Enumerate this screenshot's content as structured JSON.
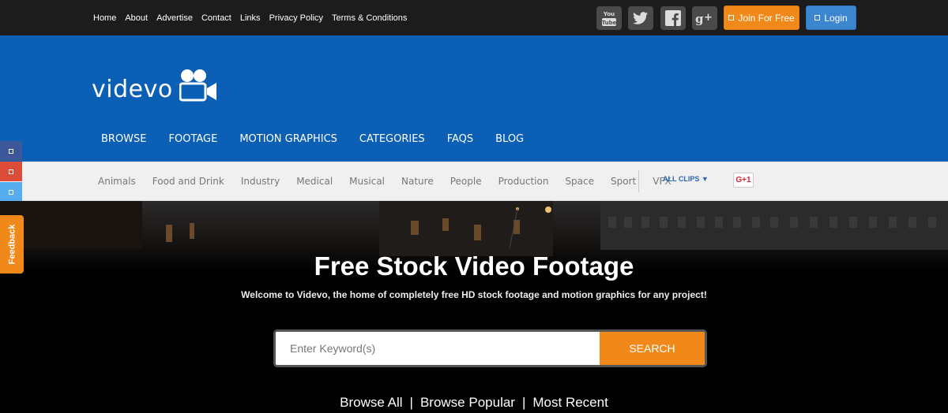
{
  "top_nav": [
    "Home",
    "About",
    "Advertise",
    "Contact",
    "Links",
    "Privacy Policy",
    "Terms & Conditions"
  ],
  "social_icons": [
    "youtube-icon",
    "twitter-icon",
    "facebook-icon",
    "google-plus-icon"
  ],
  "youtube_label": "You Tube",
  "buttons": {
    "join": "Join For Free",
    "login": "Login"
  },
  "logo": {
    "text": "videvo",
    "icon": "video-camera-icon"
  },
  "main_nav": [
    "BROWSE",
    "FOOTAGE",
    "MOTION GRAPHICS",
    "CATEGORIES",
    "FAQS",
    "BLOG"
  ],
  "categories": [
    "Animals",
    "Food and Drink",
    "Industry",
    "Medical",
    "Musical",
    "Nature",
    "People",
    "Production",
    "Space",
    "Sport",
    "VFX"
  ],
  "all_clips": "ALL CLIPS ▼",
  "gplus_button": "G+1",
  "side_tabs": {
    "feedback": "Feedback"
  },
  "hero": {
    "title": "Free Stock Video Footage",
    "subtitle": "Welcome to Videvo, the home of completely free HD stock footage and motion graphics for any project!",
    "search_placeholder": "Enter Keyword(s)",
    "search_button": "SEARCH",
    "browse_links": [
      "Browse All",
      "Browse Popular",
      "Most Recent"
    ],
    "separator": "|"
  },
  "colors": {
    "header_blue": "#0b5fb4",
    "accent_orange": "#f0891a",
    "login_blue": "#3b86cf",
    "topbar": "#1c1c1c",
    "side_tab_1": "#3b5998",
    "side_tab_2": "#dd4b39",
    "side_tab_3": "#55acee"
  }
}
